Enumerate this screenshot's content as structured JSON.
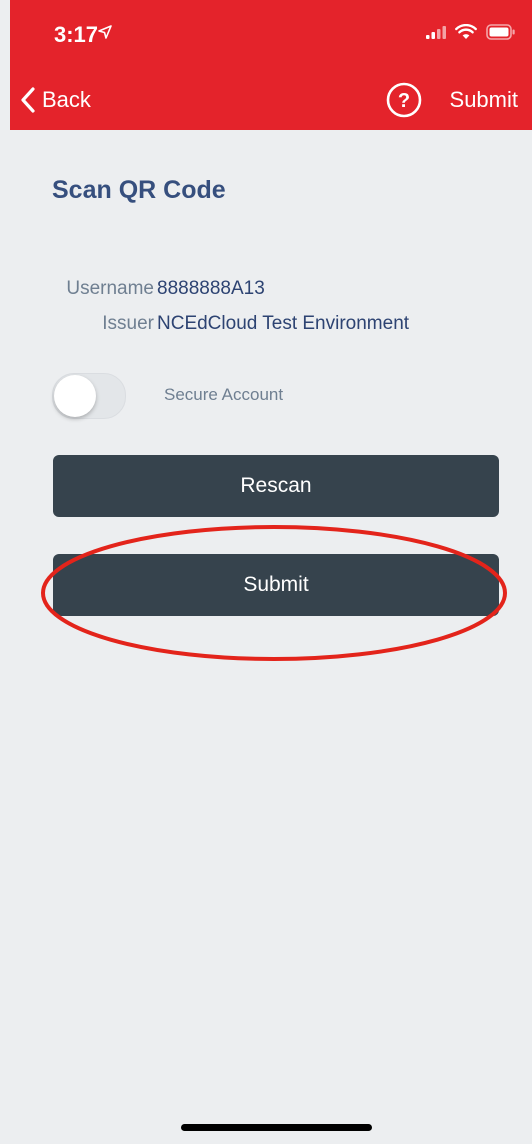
{
  "status_bar": {
    "time": "3:17"
  },
  "nav": {
    "back_label": "Back",
    "submit_label": "Submit"
  },
  "page": {
    "title": "Scan QR Code",
    "username_label": "Username",
    "username_value": "8888888A13",
    "issuer_label": "Issuer",
    "issuer_value": "NCEdCloud Test Environment",
    "secure_account_label": "Secure Account",
    "secure_account_enabled": false,
    "rescan_label": "Rescan",
    "submit_label": "Submit"
  },
  "colors": {
    "brand_red": "#e4232b",
    "title_blue": "#364f7e",
    "button_dark": "#36434d",
    "highlight": "#e3241b"
  },
  "icons": [
    "location-arrow-icon",
    "signal-icon",
    "wifi-icon",
    "battery-icon",
    "chevron-left-icon",
    "help-icon"
  ]
}
